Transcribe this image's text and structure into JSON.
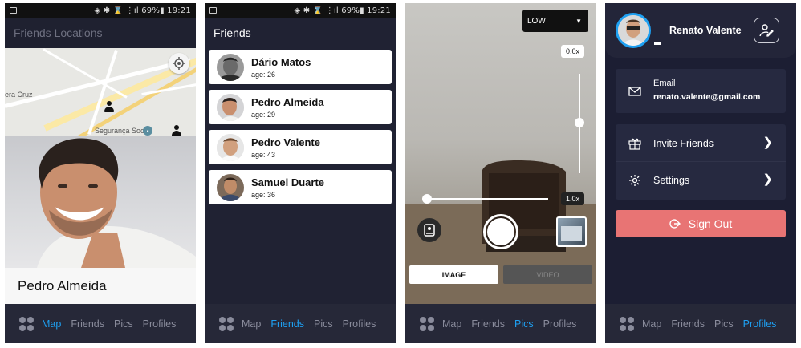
{
  "status_bar": {
    "indicators": "◈ ✱ ⌛ ⋮ıl",
    "battery": "69%",
    "time": "19:21"
  },
  "nav": {
    "map": "Map",
    "friends": "Friends",
    "pics": "Pics",
    "profiles": "Profiles"
  },
  "screen_map": {
    "title": "Friends Locations",
    "map_labels": {
      "town": "era Cruz",
      "poi": "Segurança Social"
    },
    "selected_friend_name": "Pedro Almeida"
  },
  "screen_friends": {
    "title": "Friends",
    "friends": [
      {
        "name": "Dário Matos",
        "age": "age: 26"
      },
      {
        "name": "Pedro Almeida",
        "age": "age: 29"
      },
      {
        "name": "Pedro Valente",
        "age": "age: 43"
      },
      {
        "name": "Samuel Duarte",
        "age": "age: 36"
      }
    ]
  },
  "screen_camera": {
    "quality": "LOW",
    "zoom_top": "0.0x",
    "zoom_bottom": "1.0x",
    "mode_image": "IMAGE",
    "mode_video": "VIDEO"
  },
  "screen_profile": {
    "name": "Renato Valente",
    "email_label": "Email",
    "email_value": "renato.valente@gmail.com",
    "invite_label": "Invite Friends",
    "settings_label": "Settings",
    "signout_label": "Sign Out"
  },
  "colors": {
    "accent": "#1ea0f2",
    "signout": "#e87474",
    "background": "#202233"
  }
}
